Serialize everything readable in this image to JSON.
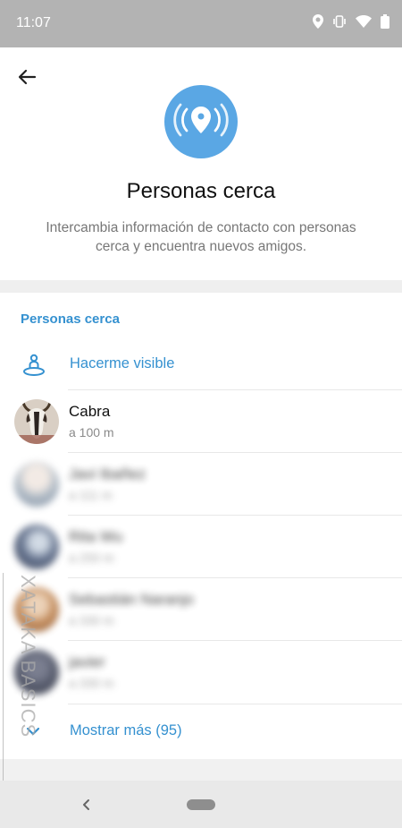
{
  "status_bar": {
    "time": "11:07",
    "icons": [
      "location-icon",
      "vibrate-icon",
      "wifi-icon",
      "battery-icon"
    ]
  },
  "header": {
    "title": "Personas cerca",
    "subtitle": "Intercambia información de contacto con personas cerca y encuentra nuevos amigos."
  },
  "section": {
    "title": "Personas cerca"
  },
  "visible_action": {
    "label": "Hacerme visible",
    "icon": "nearby-person-icon"
  },
  "people": [
    {
      "name": "Cabra",
      "distance": "a 100 m",
      "blurred": false
    },
    {
      "name": "Javi Ibañez",
      "distance": "a 111 m",
      "blurred": true
    },
    {
      "name": "Rita Wu",
      "distance": "a 250 m",
      "blurred": true
    },
    {
      "name": "Sebastián Naranjo",
      "distance": "a 330 m",
      "blurred": true
    },
    {
      "name": "javier",
      "distance": "a 330 m",
      "blurred": true
    }
  ],
  "show_more": {
    "label": "Mostrar más (95)",
    "icon": "chevron-down-icon"
  },
  "watermark": "XATAKA BASICS",
  "colors": {
    "accent": "#3591d0",
    "hero_circle": "#5aa7e4",
    "status_bar": "#b3b3b3",
    "nav_bar": "#e9e9e9"
  }
}
